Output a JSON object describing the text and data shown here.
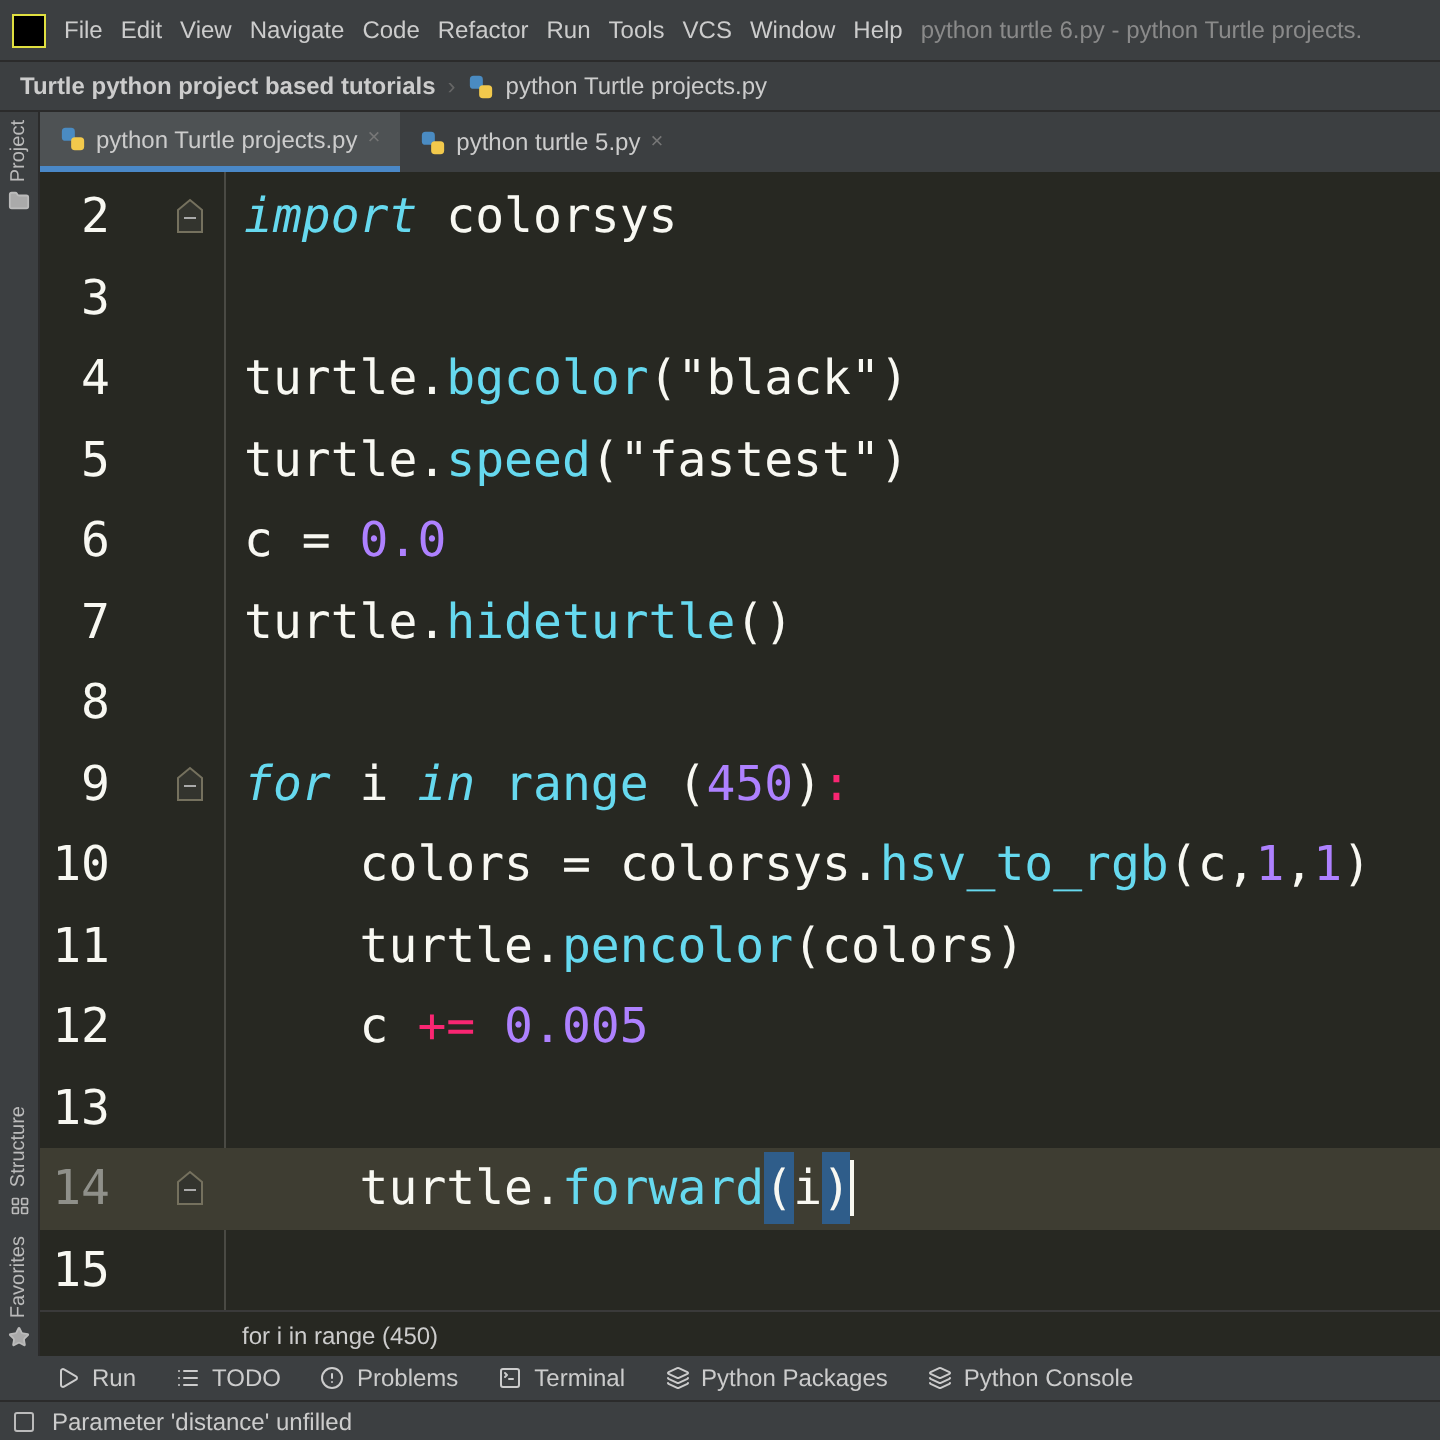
{
  "menu_bar": {
    "items": [
      "File",
      "Edit",
      "View",
      "Navigate",
      "Code",
      "Refactor",
      "Run",
      "Tools",
      "VCS",
      "Window",
      "Help"
    ],
    "title": "python turtle 6.py - python Turtle projects."
  },
  "breadcrumb": {
    "project": "Turtle python project based tutorials",
    "separator": "›",
    "file": "python Turtle projects.py"
  },
  "tabs": [
    {
      "label": "python Turtle projects.py",
      "close": "×",
      "selected": true
    },
    {
      "label": "python turtle 5.py",
      "close": "×",
      "selected": false
    }
  ],
  "left_strip": {
    "top": "Project",
    "middle": "Structure",
    "bottom": "Favorites"
  },
  "editor": {
    "lines": [
      {
        "number": "2",
        "current": false,
        "fold": true,
        "tokens": [
          {
            "kind": "keyword",
            "text": "import"
          },
          {
            "kind": "plain",
            "text": " colorsys"
          }
        ]
      },
      {
        "number": "3",
        "current": false,
        "fold": false
      },
      {
        "number": "4",
        "current": false,
        "fold": false,
        "tokens": [
          {
            "kind": "plain",
            "text": "turtle."
          },
          {
            "kind": "func",
            "text": "bgcolor"
          },
          {
            "kind": "plain",
            "text": "("
          },
          {
            "kind": "string",
            "text": "\"black\""
          },
          {
            "kind": "plain",
            "text": ")"
          }
        ]
      },
      {
        "number": "5",
        "current": false,
        "fold": false,
        "tokens": [
          {
            "kind": "plain",
            "text": "turtle."
          },
          {
            "kind": "func",
            "text": "speed"
          },
          {
            "kind": "plain",
            "text": "("
          },
          {
            "kind": "string",
            "text": "\"fastest\""
          },
          {
            "kind": "plain",
            "text": ")"
          }
        ]
      },
      {
        "number": "6",
        "current": false,
        "fold": false,
        "tokens": [
          {
            "kind": "plain",
            "text": "c = "
          },
          {
            "kind": "number",
            "text": "0.0"
          }
        ]
      },
      {
        "number": "7",
        "current": false,
        "fold": false,
        "tokens": [
          {
            "kind": "plain",
            "text": "turtle."
          },
          {
            "kind": "func",
            "text": "hideturtle"
          },
          {
            "kind": "plain",
            "text": "()"
          }
        ]
      },
      {
        "number": "8",
        "current": false,
        "fold": false
      },
      {
        "number": "9",
        "current": false,
        "fold": true,
        "tokens": [
          {
            "kind": "keyword",
            "text": "for"
          },
          {
            "kind": "plain",
            "text": " i "
          },
          {
            "kind": "keyword",
            "text": "in"
          },
          {
            "kind": "func",
            "text": " range"
          },
          {
            "kind": "plain",
            "text": " ("
          },
          {
            "kind": "number",
            "text": "450"
          },
          {
            "kind": "plain",
            "text": ")"
          },
          {
            "kind": "op",
            "text": ":"
          }
        ]
      },
      {
        "number": "10",
        "current": false,
        "fold": false,
        "tokens": [
          {
            "kind": "plain",
            "text": "    colors = colorsys."
          },
          {
            "kind": "func",
            "text": "hsv_to_rgb"
          },
          {
            "kind": "plain",
            "text": "(c,"
          },
          {
            "kind": "number",
            "text": "1"
          },
          {
            "kind": "plain",
            "text": ","
          },
          {
            "kind": "number",
            "text": "1"
          },
          {
            "kind": "plain",
            "text": ")"
          }
        ]
      },
      {
        "number": "11",
        "current": false,
        "fold": false,
        "tokens": [
          {
            "kind": "plain",
            "text": "    turtle."
          },
          {
            "kind": "func",
            "text": "pencolor"
          },
          {
            "kind": "plain",
            "text": "(colors)"
          }
        ]
      },
      {
        "number": "12",
        "current": false,
        "fold": false,
        "tokens": [
          {
            "kind": "plain",
            "text": "    c "
          },
          {
            "kind": "op",
            "text": "+="
          },
          {
            "kind": "number",
            "text": " 0.005"
          }
        ]
      },
      {
        "number": "13",
        "current": false,
        "fold": false
      },
      {
        "number": "14",
        "current": true,
        "fold": true,
        "tokens": [
          {
            "kind": "plain",
            "text": "    turtle."
          },
          {
            "kind": "func",
            "text": "forward"
          },
          {
            "kind": "match",
            "text": "("
          },
          {
            "kind": "plain",
            "text": "i"
          },
          {
            "kind": "match",
            "text": ")"
          }
        ]
      },
      {
        "number": "15",
        "current": false,
        "fold": false
      }
    ]
  },
  "context_line": "for i in range (450)",
  "tool_windows": [
    "Run",
    "TODO",
    "Problems",
    "Terminal",
    "Python Packages",
    "Python Console"
  ],
  "status": "Parameter 'distance' unfilled"
}
